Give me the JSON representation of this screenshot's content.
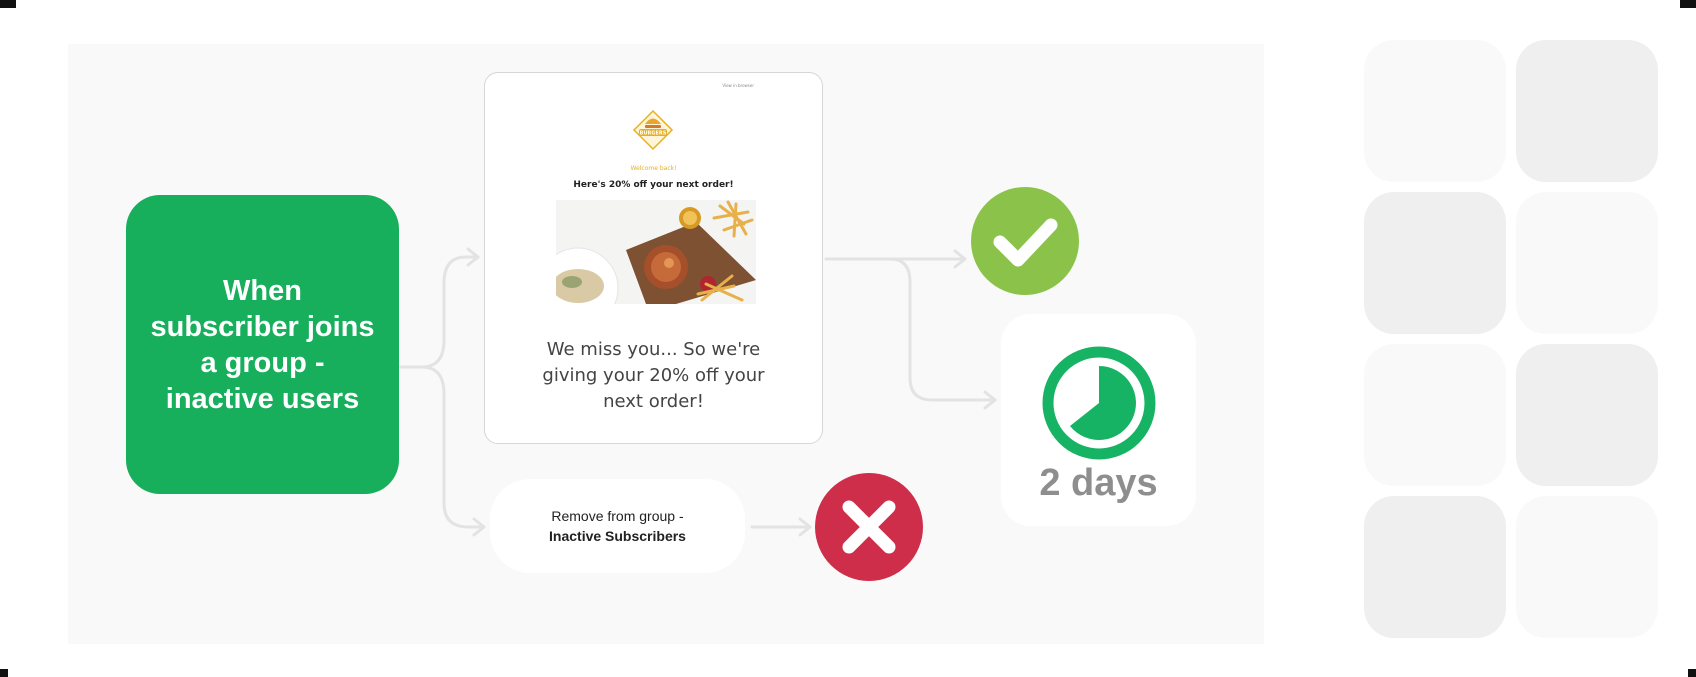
{
  "trigger": {
    "label": "When subscriber joins a group - inactive users",
    "color": "#17ae5c"
  },
  "email": {
    "top_link": "View in browser",
    "logo_text": "BURGERS",
    "welcome": "Welcome back!",
    "headline": "Here's 20% off your next order!",
    "body": "We miss you... So we're giving your 20% off your next order!"
  },
  "action": {
    "line1": "Remove from group -",
    "line2": "Inactive Subscribers"
  },
  "delay": {
    "label": "2 days",
    "color": "#17b364"
  },
  "status": {
    "success_color": "#8bc34a",
    "fail_color": "#cf2e4a",
    "success_icon": "check-icon",
    "fail_icon": "x-icon"
  },
  "decor_tiles": [
    {
      "shade": "#f9f9f9"
    },
    {
      "shade": "#efefef"
    },
    {
      "shade": "#efefef"
    },
    {
      "shade": "#f9f9f9"
    },
    {
      "shade": "#f9f9f9"
    },
    {
      "shade": "#efefef"
    },
    {
      "shade": "#efefef"
    },
    {
      "shade": "#f9f9f9"
    }
  ]
}
